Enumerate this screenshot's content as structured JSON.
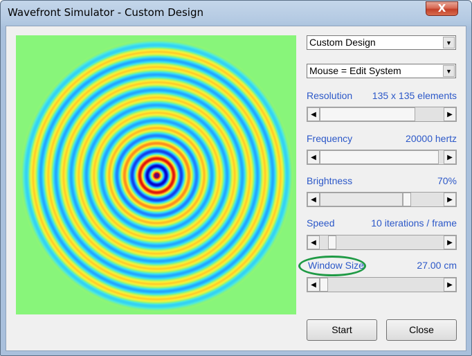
{
  "window": {
    "title": "Wavefront Simulator - Custom Design",
    "close_glyph": "X"
  },
  "design_select": {
    "value": "Custom Design"
  },
  "mouse_select": {
    "value": "Mouse = Edit System"
  },
  "controls": {
    "resolution": {
      "label": "Resolution",
      "value": "135 x 135 elements",
      "slider_fraction": 0.75
    },
    "frequency": {
      "label": "Frequency",
      "value": "20000 hertz",
      "slider_fraction": 1.0
    },
    "brightness": {
      "label": "Brightness",
      "value": "70%",
      "slider_fraction": 0.7
    },
    "speed": {
      "label": "Speed",
      "value": "10 iterations / frame",
      "slider_fraction": 0.05
    },
    "window_size": {
      "label": "Window Size",
      "value": "27.00 cm",
      "slider_fraction": 0.02
    }
  },
  "buttons": {
    "start": "Start",
    "close": "Close"
  },
  "icons": {
    "dropdown_arrow": "▼",
    "scroll_left": "◀",
    "scroll_right": "▶"
  },
  "colors": {
    "label_blue": "#2c58c8",
    "annotation_green": "#1f9a45",
    "wave_background": "#88f57a"
  },
  "visualization": {
    "type": "concentric-wavefront"
  }
}
